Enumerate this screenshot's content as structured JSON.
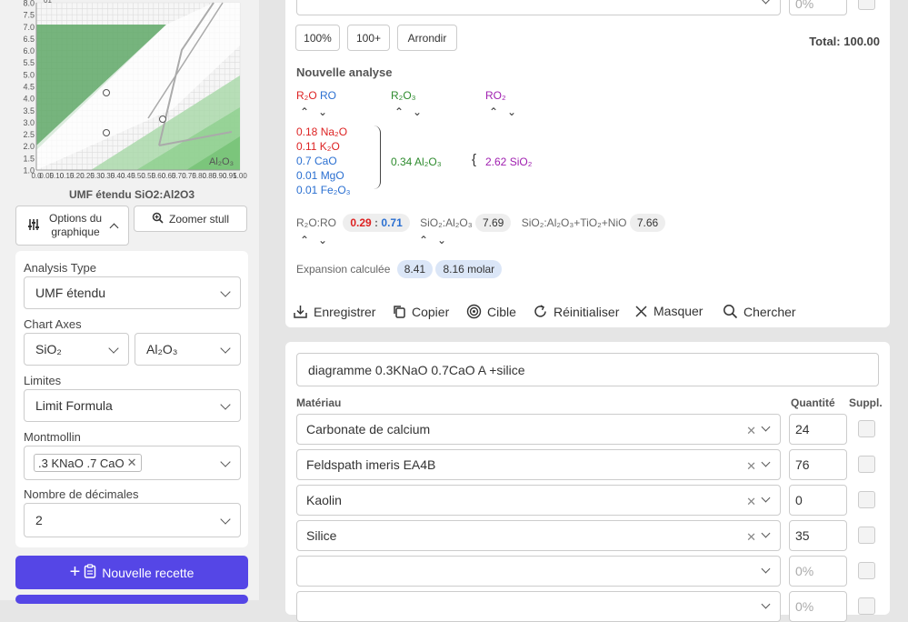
{
  "chart": {
    "y_ticks": [
      "8.0",
      "7.5",
      "7.0",
      "6.5",
      "6.0",
      "5.5",
      "5.0",
      "4.5",
      "4.0",
      "3.5",
      "3.0",
      "2.5",
      "2.0",
      "1.5",
      "1.0"
    ],
    "x_ticks": [
      "0.0",
      "0.05",
      "0.10",
      "0.15",
      "0.20",
      "0.25",
      "0.30",
      "0.35",
      "0.40",
      "0.45",
      "0.50",
      "0.55",
      "0.60",
      "0.65",
      "0.70",
      "0.75",
      "0.80",
      "0.85",
      "0.90",
      "0.95",
      "1.00"
    ],
    "corner_label": "Al₂O₃",
    "top_label": "01",
    "title": "UMF étendu SiO2:Al2O3"
  },
  "chart_options": {
    "label_line1": "Options du",
    "label_line2": "graphique",
    "zoom_label": "Zoomer stull"
  },
  "settings": {
    "analysis_type": {
      "label": "Analysis Type",
      "value": "UMF étendu"
    },
    "chart_axes": {
      "label": "Chart Axes",
      "x": "SiO₂",
      "y": "Al₂O₃"
    },
    "limites": {
      "label": "Limites",
      "value": "Limit Formula"
    },
    "montmollin": {
      "label": "Montmollin",
      "chip": ".3 KNaO .7 CaO"
    },
    "decimales": {
      "label": "Nombre de décimales",
      "value": "2"
    }
  },
  "buttons": {
    "new_recipe": "Nouvelle recette"
  },
  "top": {
    "percent_placeholder": "0%",
    "btn_100": "100%",
    "btn_100plus": "100+",
    "btn_round": "Arrondir",
    "total": "Total: 100.00"
  },
  "analysis": {
    "title": "Nouvelle analyse",
    "hdr_r2o": "R₂O",
    "hdr_ro": "RO",
    "hdr_r2o3": "R₂O₃",
    "hdr_ro2": "RO₂",
    "fluxes": [
      {
        "text": "0.18 Na₂O",
        "color": "red"
      },
      {
        "text": "0.11 K₂O",
        "color": "red"
      },
      {
        "text": "0.7 CaO",
        "color": "blue"
      },
      {
        "text": "0.01 MgO",
        "color": "blue"
      },
      {
        "text": "0.01 Fe₂O₃",
        "color": "blue"
      }
    ],
    "al2o3": "0.34 Al₂O₃",
    "sio2": "2.62 SiO₂",
    "ratio_label": "R₂O:RO",
    "ratio_r2o": "0.29",
    "ratio_sep": ":",
    "ratio_ro": "0.71",
    "si_al_label": "SiO₂:Al₂O₃",
    "si_al_value": "7.69",
    "si_al_ti_label": "SiO₂:Al₂O₃+TiO₂+NiO",
    "si_al_ti_value": "7.66",
    "expansion_label": "Expansion calculée",
    "expansion_value": "8.41",
    "expansion_molar": "8.16 molar"
  },
  "actions": {
    "save": "Enregistrer",
    "copy": "Copier",
    "target": "Cible",
    "reset": "Réinitialiser",
    "hide": "Masquer",
    "search": "Chercher"
  },
  "recipe": {
    "name": "diagramme 0.3KNaO 0.7CaO A +silice",
    "col_material": "Matériau",
    "col_qty": "Quantité",
    "col_suppl": "Suppl.",
    "rows": [
      {
        "material": "Carbonate de calcium",
        "qty": "24"
      },
      {
        "material": "Feldspath imeris EA4B",
        "qty": "76"
      },
      {
        "material": "Kaolin",
        "qty": "0"
      },
      {
        "material": "Silice",
        "qty": "35"
      }
    ],
    "empty_qty_placeholder": "0%"
  }
}
